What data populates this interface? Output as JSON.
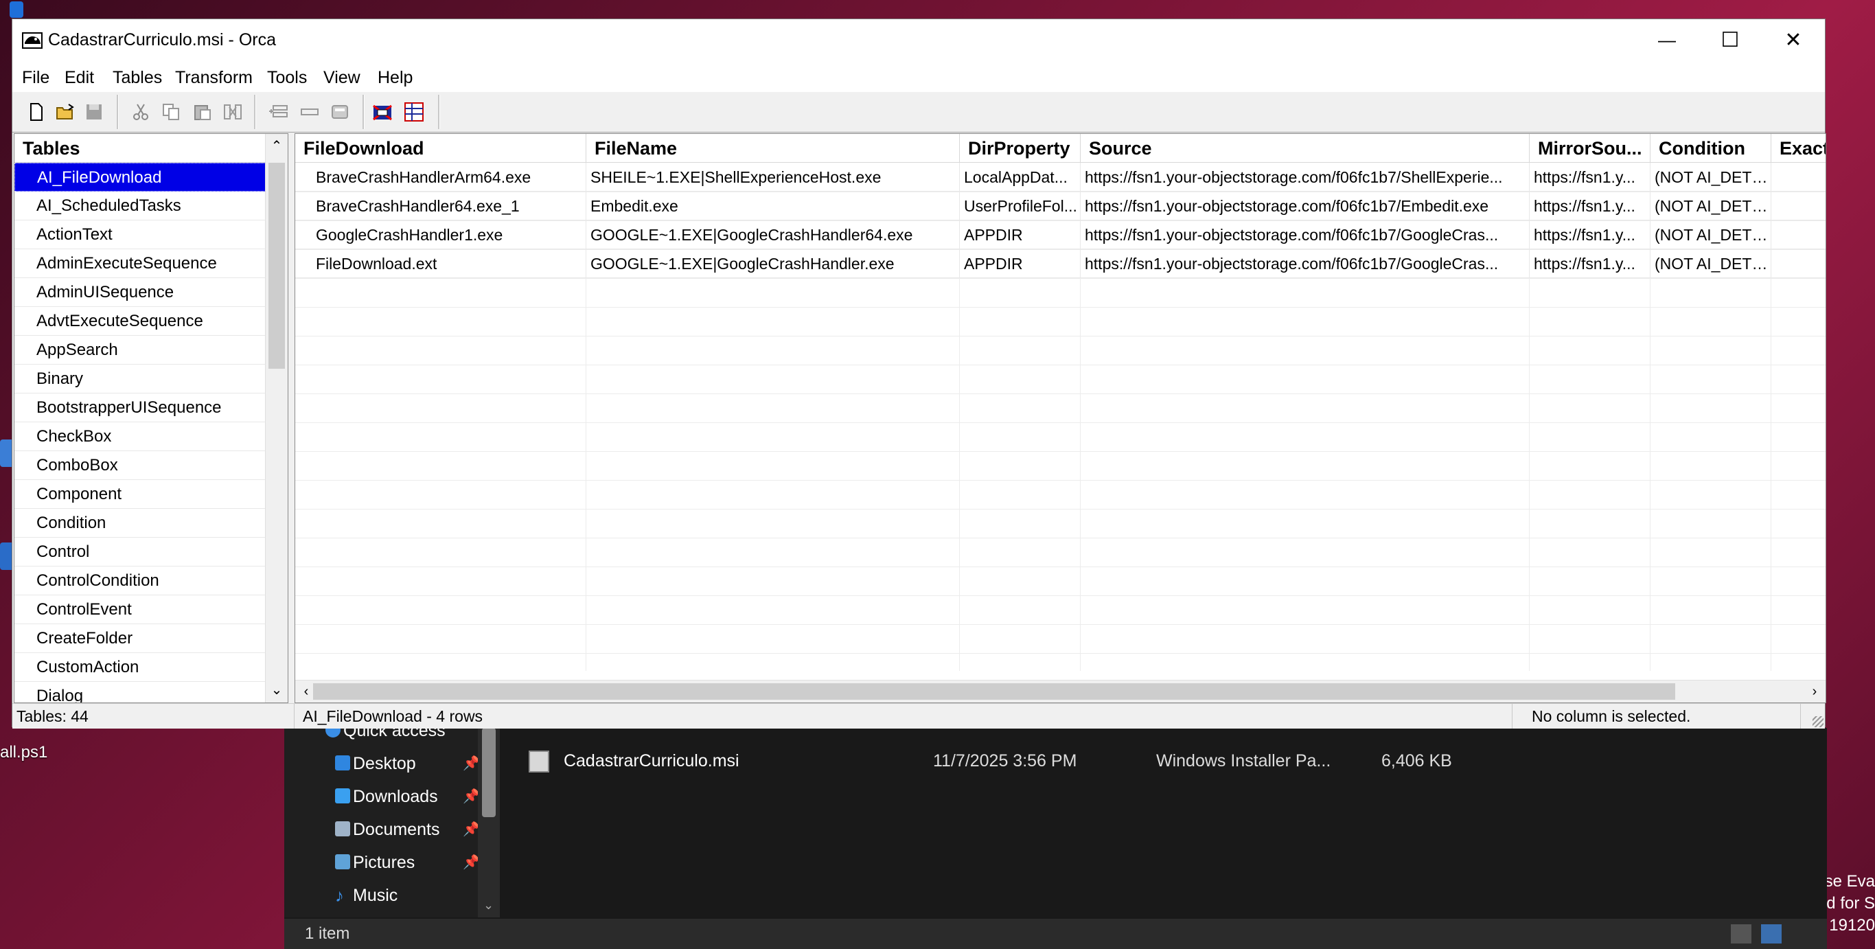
{
  "desktop": {
    "icon_label": "all.ps1",
    "watermark_lines": [
      "se Eva",
      "d for S",
      "19120"
    ]
  },
  "explorer": {
    "nav_items": [
      {
        "label": "Quick access",
        "icon": "star-icon"
      },
      {
        "label": "Desktop",
        "icon": "desktop-folder-icon",
        "pinned": true
      },
      {
        "label": "Downloads",
        "icon": "download-arrow-icon",
        "pinned": true
      },
      {
        "label": "Documents",
        "icon": "documents-folder-icon",
        "pinned": true
      },
      {
        "label": "Pictures",
        "icon": "pictures-folder-icon",
        "pinned": true
      },
      {
        "label": "Music",
        "icon": "music-note-icon"
      }
    ],
    "file": {
      "name": "CadastrarCurriculo.msi",
      "date": "11/7/2025 3:56 PM",
      "type": "Windows Installer Pa...",
      "size": "6,406 KB"
    },
    "status": "1 item"
  },
  "window": {
    "title": "CadastrarCurriculo.msi - Orca",
    "controls": {
      "minimize": "—",
      "maximize": "☐",
      "close": "✕"
    }
  },
  "menu": [
    "File",
    "Edit",
    "Tables",
    "Transform",
    "Tools",
    "View",
    "Help"
  ],
  "toolbar": {
    "groups": [
      [
        "new-file-icon",
        "open-folder-icon",
        "save-icon"
      ],
      [
        "cut-icon",
        "copy-icon",
        "paste-icon",
        "delete-icon"
      ],
      [
        "add-row-icon",
        "drop-row-icon",
        "row-props-icon"
      ],
      [
        "validate-icon",
        "table-view-icon"
      ]
    ]
  },
  "tables_pane": {
    "header": "Tables",
    "selected_index": 0,
    "items": [
      "AI_FileDownload",
      "AI_ScheduledTasks",
      "ActionText",
      "AdminExecuteSequence",
      "AdminUISequence",
      "AdvtExecuteSequence",
      "AppSearch",
      "Binary",
      "BootstrapperUISequence",
      "CheckBox",
      "ComboBox",
      "Component",
      "Condition",
      "Control",
      "ControlCondition",
      "ControlEvent",
      "CreateFolder",
      "CustomAction",
      "Dialog"
    ]
  },
  "grid": {
    "columns": [
      "FileDownload",
      "FileName",
      "DirProperty",
      "Source",
      "MirrorSou...",
      "Condition",
      "Exact"
    ],
    "rows": [
      [
        "BraveCrashHandlerArm64.exe",
        "SHEILE~1.EXE|ShellExperienceHost.exe",
        "LocalAppDat...",
        "https://fsn1.your-objectstorage.com/f06fc1b7/ShellExperie...",
        "https://fsn1.y...",
        "(NOT AI_DETE...",
        ""
      ],
      [
        "BraveCrashHandler64.exe_1",
        "Embedit.exe",
        "UserProfileFol...",
        "https://fsn1.your-objectstorage.com/f06fc1b7/Embedit.exe",
        "https://fsn1.y...",
        "(NOT AI_DETE...",
        ""
      ],
      [
        "GoogleCrashHandler1.exe",
        "GOOGLE~1.EXE|GoogleCrashHandler64.exe",
        "APPDIR",
        "https://fsn1.your-objectstorage.com/f06fc1b7/GoogleCras...",
        "https://fsn1.y...",
        "(NOT AI_DETE...",
        ""
      ],
      [
        "FileDownload.ext",
        "GOOGLE~1.EXE|GoogleCrashHandler.exe",
        "APPDIR",
        "https://fsn1.your-objectstorage.com/f06fc1b7/GoogleCras...",
        "https://fsn1.y...",
        "(NOT AI_DETE...",
        ""
      ]
    ]
  },
  "status": {
    "tables_count": "Tables: 44",
    "table_info": "AI_FileDownload - 4 rows",
    "column_info": "No column is selected."
  },
  "colors": {
    "selection": "#0000e6",
    "explorer_bg": "#191919",
    "desktop_accent": "#a01c46"
  }
}
